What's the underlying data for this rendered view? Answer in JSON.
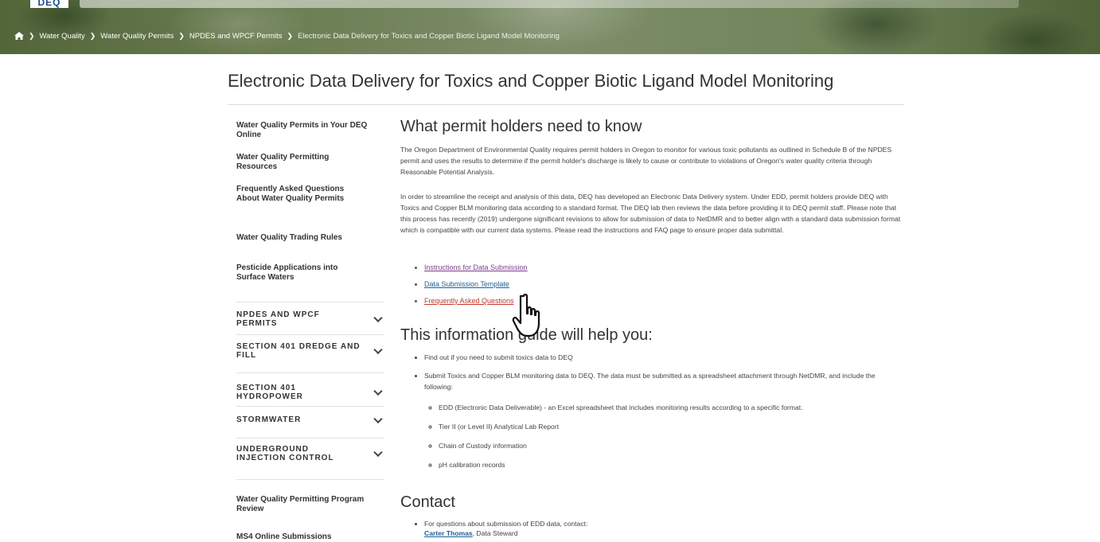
{
  "header": {
    "logo_text": "DEQ"
  },
  "breadcrumb": {
    "items": [
      "Water Quality",
      "Water Quality Permits",
      "NPDES and WPCF Permits"
    ],
    "current": "Electronic Data Delivery for Toxics and Copper Biotic Ligand Model Monitoring"
  },
  "page": {
    "title": "Electronic Data Delivery for Toxics and Copper Biotic Ligand Model Monitoring"
  },
  "sidebar": {
    "links_top": [
      "Water Quality Permits in Your DEQ Online",
      "Water Quality Permitting Resources",
      "Frequently Asked Questions About Water Quality Permits",
      "Water Quality Trading Rules",
      "Pesticide Applications into Surface Waters"
    ],
    "categories": [
      "NPDES AND WPCF PERMITS",
      "SECTION 401 DREDGE AND FILL",
      "SECTION 401 HYDROPOWER",
      "STORMWATER",
      "UNDERGROUND INJECTION CONTROL"
    ],
    "links_bottom": [
      "Water Quality Permitting Program Review",
      "MS4 Online Submissions"
    ]
  },
  "main": {
    "section1": {
      "heading": "What permit holders need to know",
      "p1": "The Oregon Department of Environmental Quality requires permit holders in Oregon to monitor for various toxic pollutants as outlined in Schedule B of the NPDES permit and uses the results to determine if the permit holder's discharge is likely to cause or contribute to violations of Oregon's water quality criteria through Reasonable Potential Analysis.",
      "p2": "In order to streamline the receipt and analysis of this data, DEQ has developed an Electronic Data Delivery system.  Under EDD, permit holders provide DEQ with Toxics and Copper BLM monitoring data according to a standard format. The DEQ lab then reviews the data before providing it to DEQ permit staff. Please note that this process has recently (2019) undergone significant revisions to allow for submission of data to NetDMR and to better align with a standard data submission format which is compatible with our current data systems. Please read the instructions and FAQ page to ensure proper data submittal.",
      "links": [
        "Instructions for Data Submission",
        "Data Submission Template",
        "Frequently Asked Questions"
      ]
    },
    "section2": {
      "heading": "This information guide will help you:",
      "bullets": [
        "Find out if you need to submit toxics data to DEQ",
        "Submit Toxics and Copper BLM monitoring data to DEQ. The data must be submitted as a spreadsheet attachment through NetDMR, and include the following:"
      ],
      "sub_bullets": [
        "EDD (Electronic Data Deliverable) - an Excel spreadsheet that includes monitoring results according to a specific format.",
        "Tier II (or Level II) Analytical Lab Report",
        "Chain of Custody information",
        "pH calibration records"
      ]
    },
    "section3": {
      "heading": "Contact",
      "bullet": "For questions about submission of EDD data, contact:",
      "contact_name": "Carter Thomas",
      "contact_role": ", Data Steward"
    }
  },
  "colors": {
    "link_visited": "#7b3f8c",
    "link": "#1f5f99",
    "link_active": "#c0392b"
  }
}
